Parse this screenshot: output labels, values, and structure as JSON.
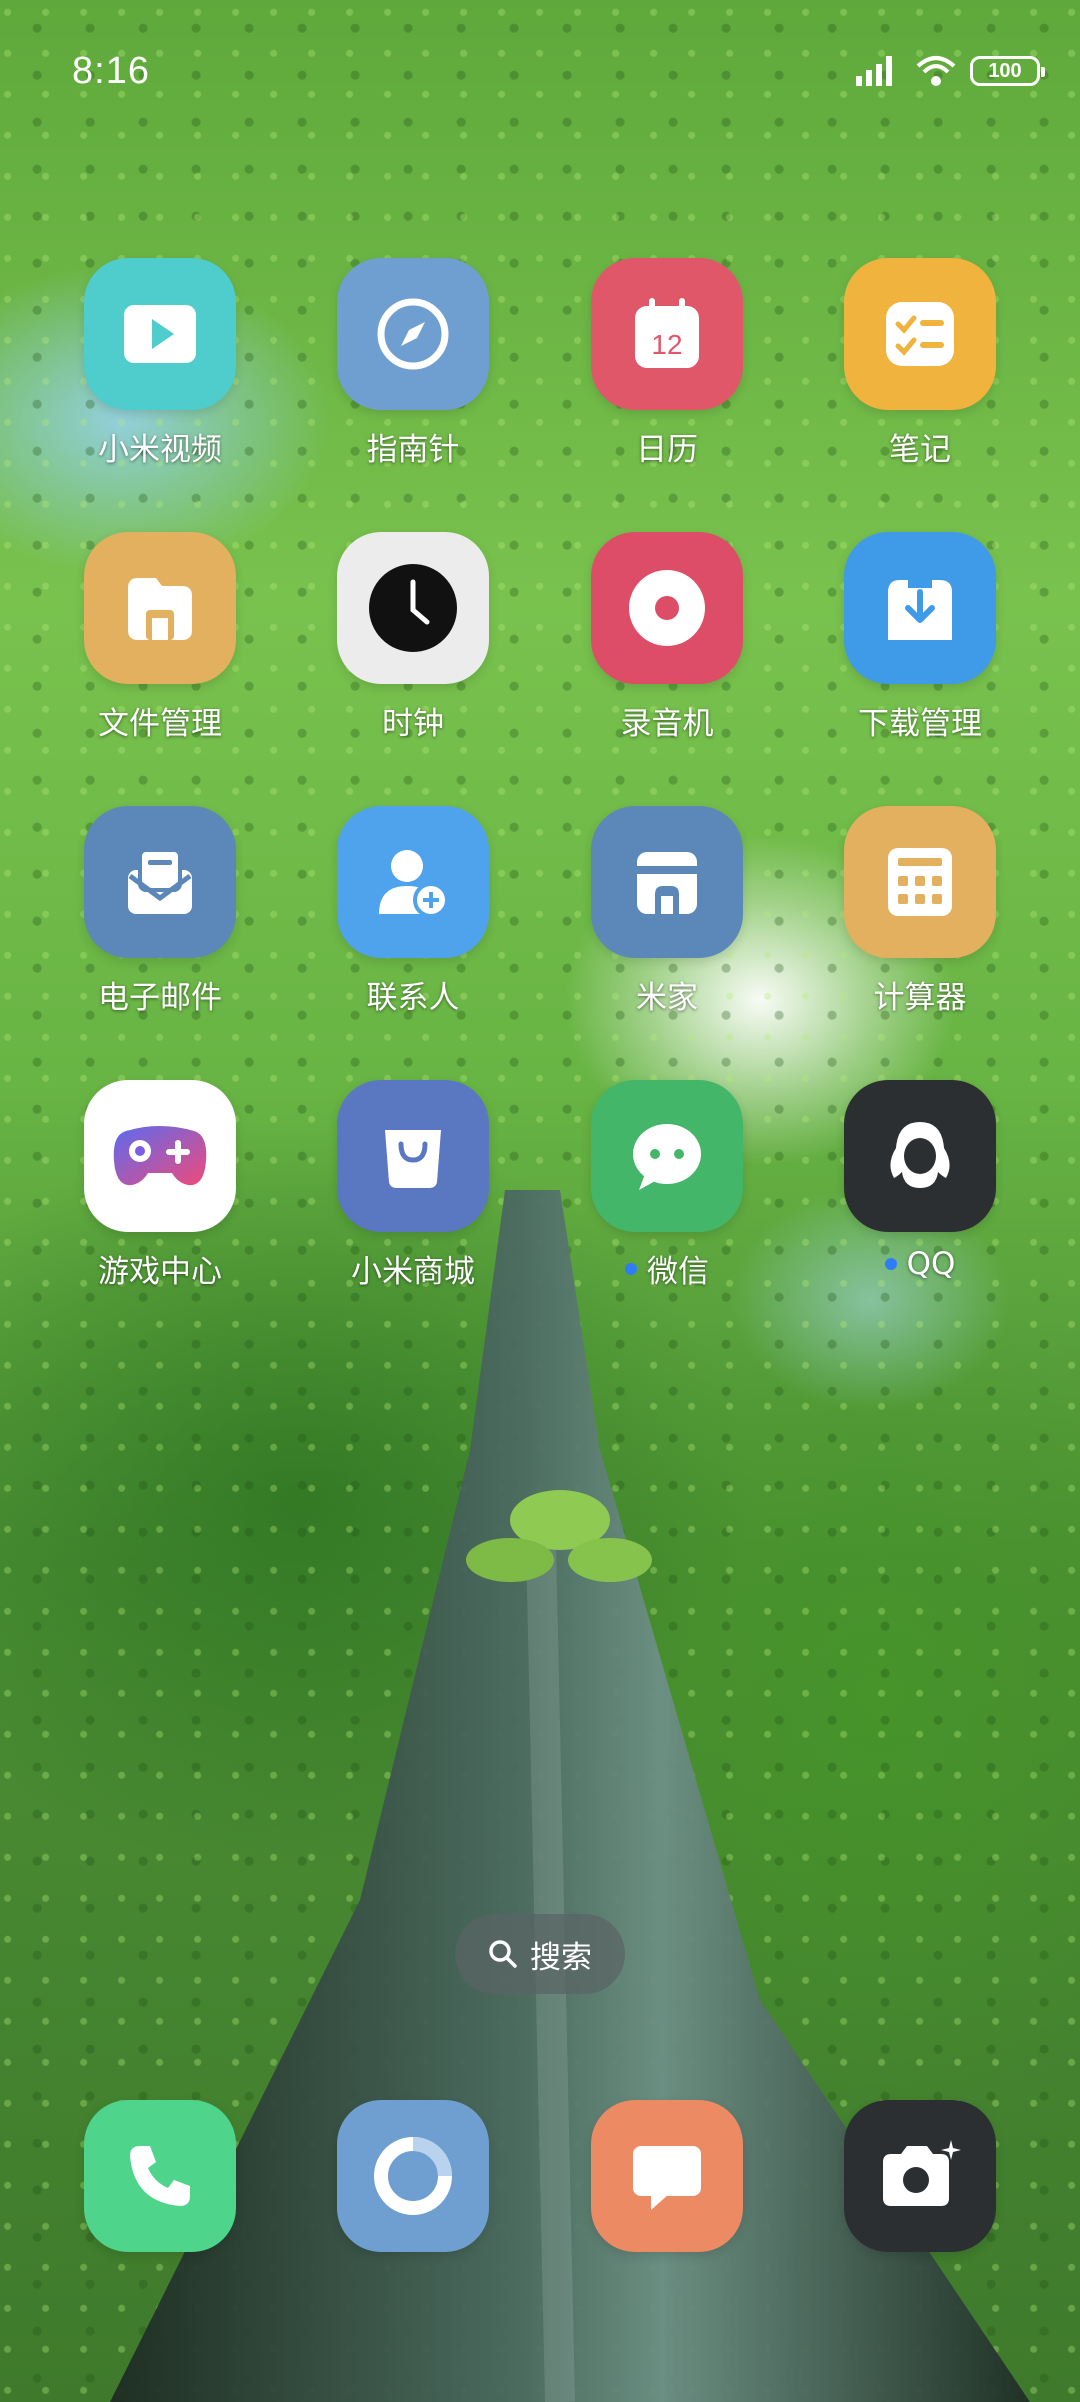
{
  "status_bar": {
    "time": "8:16",
    "battery": "100"
  },
  "apps": [
    {
      "label": "小米视频",
      "icon": "video-play-icon",
      "color": "#4fcccc"
    },
    {
      "label": "指南针",
      "icon": "compass-icon",
      "color": "#6f9fd1"
    },
    {
      "label": "日历",
      "icon": "calendar-icon",
      "calendar_day": "12",
      "color": "#e0576a"
    },
    {
      "label": "笔记",
      "icon": "notes-checklist-icon",
      "color": "#efb33e"
    },
    {
      "label": "文件管理",
      "icon": "folder-icon",
      "color": "#e2b05e"
    },
    {
      "label": "时钟",
      "icon": "clock-icon",
      "color": "#ececec"
    },
    {
      "label": "录音机",
      "icon": "recorder-icon",
      "color": "#dd4d67"
    },
    {
      "label": "下载管理",
      "icon": "download-icon",
      "color": "#3f9ae8"
    },
    {
      "label": "电子邮件",
      "icon": "mail-icon",
      "color": "#5b88b8"
    },
    {
      "label": "联系人",
      "icon": "contacts-icon",
      "color": "#4ea3ec"
    },
    {
      "label": "米家",
      "icon": "mijia-home-icon",
      "color": "#5b88b8"
    },
    {
      "label": "计算器",
      "icon": "calculator-icon",
      "color": "#e2b05e"
    },
    {
      "label": "游戏中心",
      "icon": "gamepad-icon",
      "color": "#ffffff"
    },
    {
      "label": "小米商城",
      "icon": "shopping-bag-icon",
      "color": "#5a78c2"
    },
    {
      "label": "微信",
      "icon": "wechat-icon",
      "color": "#43b66a",
      "new_dot": true
    },
    {
      "label": "QQ",
      "icon": "qq-penguin-icon",
      "color": "#2c2f31",
      "new_dot": true
    }
  ],
  "search": {
    "label": "搜索"
  },
  "dock": [
    {
      "icon": "phone-icon",
      "color": "#4fd48c"
    },
    {
      "icon": "browser-ring-icon",
      "color": "#6f9fd1"
    },
    {
      "icon": "message-icon",
      "color": "#ec8a63"
    },
    {
      "icon": "camera-icon",
      "color": "#2c2f31"
    }
  ]
}
